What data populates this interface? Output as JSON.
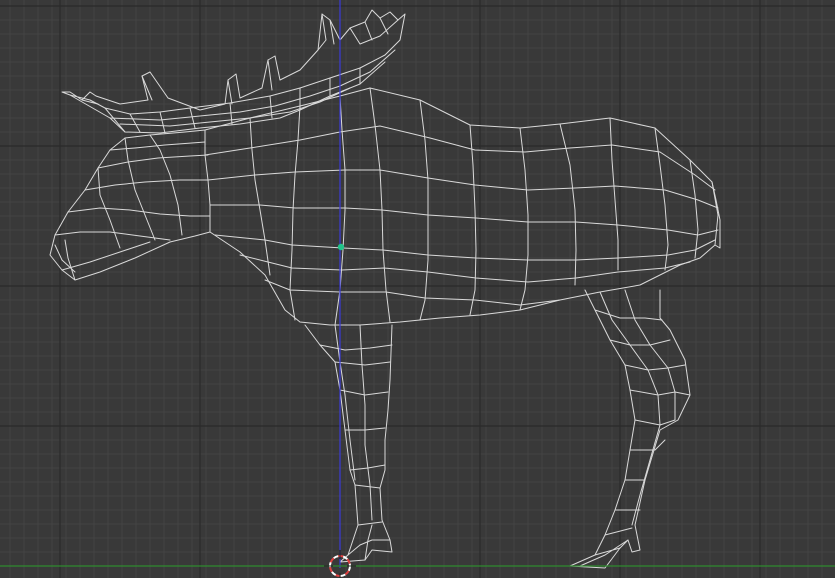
{
  "viewport": {
    "mode": "wireframe",
    "view": "side-orthographic",
    "colors": {
      "background": "#393939",
      "grid_minor": "#444444",
      "grid_major": "#2a2a2a",
      "wire": "#d9d9d9",
      "z_axis": "#3a3ad8",
      "x_axis": "#2f8a2f",
      "origin_dot": "#22c38a",
      "cursor_red": "#e04040",
      "cursor_white": "#ffffff"
    }
  },
  "scene": {
    "object": "moose-mesh",
    "icons": [
      "origin-dot-icon",
      "3d-cursor-icon"
    ]
  }
}
